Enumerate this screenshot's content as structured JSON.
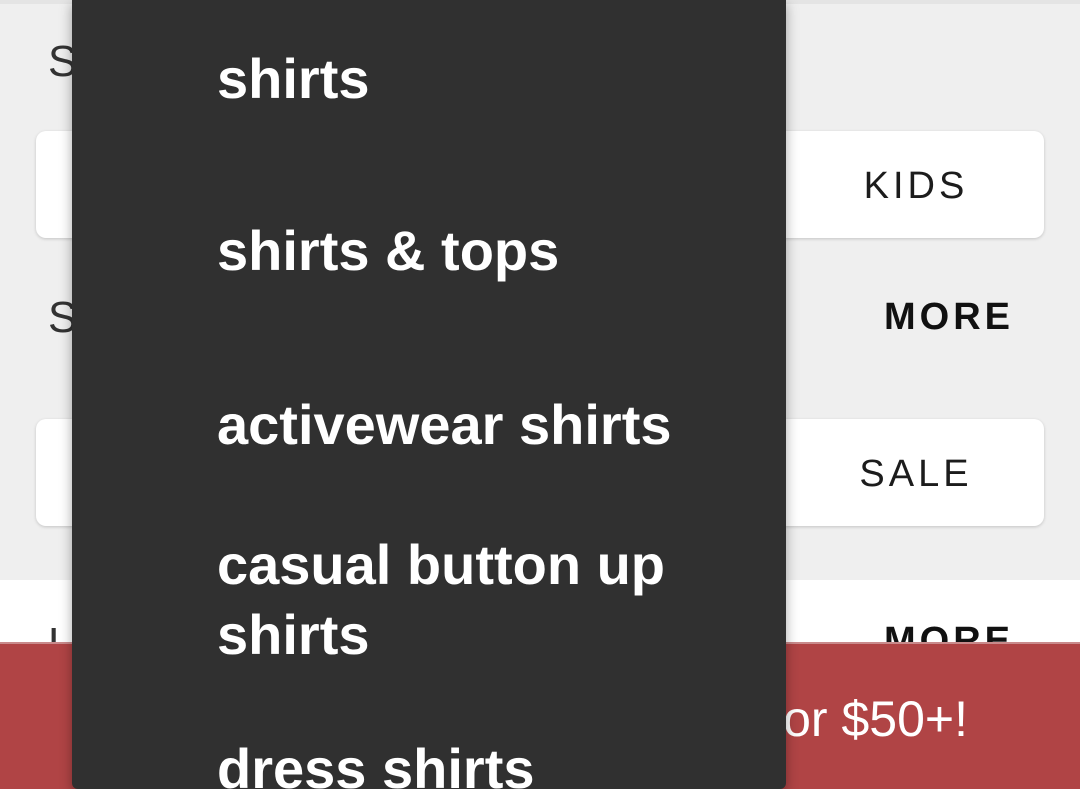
{
  "page": {
    "sections": [
      {
        "heading": "S",
        "card_label": "KIDS",
        "more_label": "MORE"
      },
      {
        "heading": "S",
        "card_label": "SALE"
      },
      {
        "heading": "L",
        "more_label": "MORE"
      }
    ]
  },
  "promo_banner": {
    "text": "or $50+!"
  },
  "suggestions": [
    "shirts",
    "shirts & tops",
    "activewear shirts",
    "casual button up shirts",
    "dress shirts"
  ],
  "colors": {
    "background": "#efefef",
    "popup": "#303030",
    "banner": "#b04445"
  }
}
